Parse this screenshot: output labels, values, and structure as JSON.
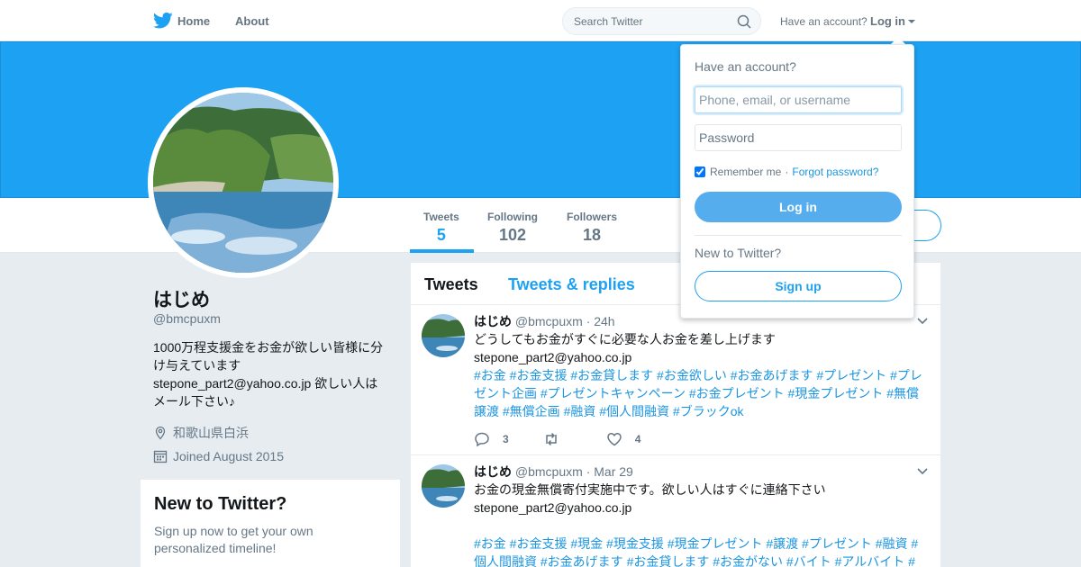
{
  "nav": {
    "home": "Home",
    "about": "About",
    "search_placeholder": "Search Twitter",
    "have_account": "Have an account?",
    "login": "Log in"
  },
  "profile": {
    "name": "はじめ",
    "handle": "@bmcpuxm",
    "bio": "1000万程支援金をお金が欲しい皆様に分け与えています\nstepone_part2@yahoo.co.jp 欲しい人はメール下さい♪",
    "location": "和歌山県白浜",
    "joined": "Joined August 2015"
  },
  "stats": [
    {
      "label": "Tweets",
      "value": "5"
    },
    {
      "label": "Following",
      "value": "102"
    },
    {
      "label": "Followers",
      "value": "18"
    }
  ],
  "timeline": {
    "tabs": [
      "Tweets",
      "Tweets & replies"
    ],
    "tweets": [
      {
        "name": "はじめ",
        "handle": "@bmcpuxm",
        "time": "· 24h",
        "text": "どうしてもお金がすぐに必要な人お金を差し上げます\nstepone_part2@yahoo.co.jp",
        "tags": "#お金 #お金支援 #お金貸します #お金欲しい #お金あげます #プレゼント #プレゼント企画 #プレゼントキャンペーン #お金プレゼント #現金プレゼント #無償譲渡 #無償企画 #融資 #個人間融資 #ブラックok",
        "replies": "3",
        "retweets": "",
        "likes": "4"
      },
      {
        "name": "はじめ",
        "handle": "@bmcpuxm",
        "time": "· Mar 29",
        "text": "お金の現金無償寄付実施中です。欲しい人はすぐに連絡下さい\nstepone_part2@yahoo.co.jp\n",
        "tags": "#お金 #お金支援 #現金 #現金支援 #現金プレゼント #譲渡 #プレゼント #融資 #個人間融資 #お金あげます #お金貸します #お金がない #バイト #アルバイト #お"
      }
    ]
  },
  "new_card": {
    "title": "New to Twitter?",
    "text": "Sign up now to get your own personalized timeline!"
  },
  "login_dropdown": {
    "title": "Have an account?",
    "username_placeholder": "Phone, email, or username",
    "password_placeholder": "Password",
    "remember": "Remember me",
    "separator": "·",
    "forgot": "Forgot password?",
    "login_button": "Log in",
    "new_to_twitter": "New to Twitter?",
    "signup_button": "Sign up"
  },
  "colors": {
    "accent": "#1da1f2",
    "link": "#1b95e0",
    "background": "#e6ecf0"
  }
}
